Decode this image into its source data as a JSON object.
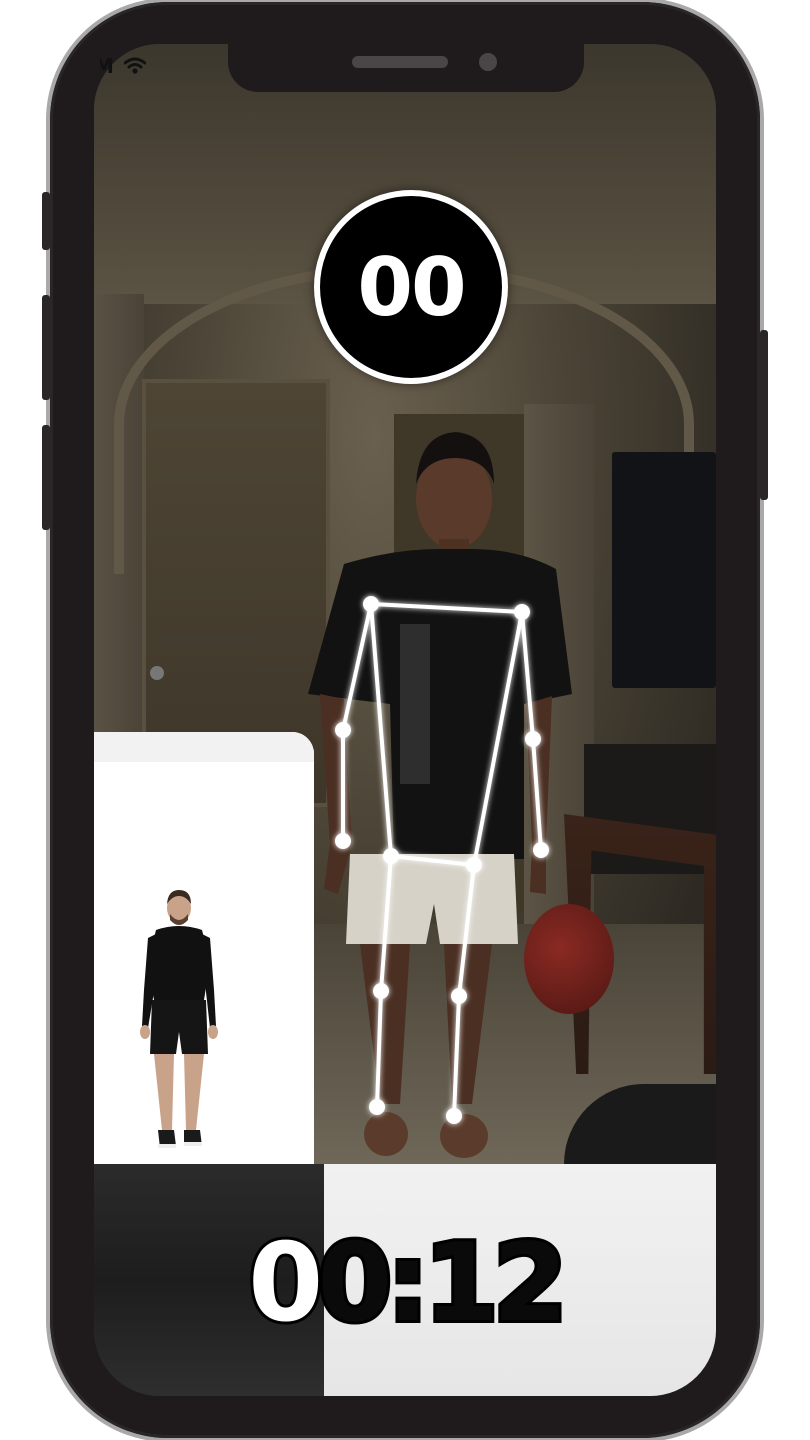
{
  "status_bar": {
    "time_fragment": "M",
    "wifi_icon": "wifi-icon"
  },
  "rep_counter": {
    "value": "00"
  },
  "timer": {
    "first_digit": "0",
    "rest": "0:12"
  },
  "reference_video": {
    "description_icon": "athlete-figure"
  },
  "colors": {
    "counter_bg": "#000000",
    "counter_ring": "#ffffff",
    "skeleton": "#ffffff",
    "timer_dark_bg": "#222222",
    "timer_light_bg": "#ececec"
  }
}
